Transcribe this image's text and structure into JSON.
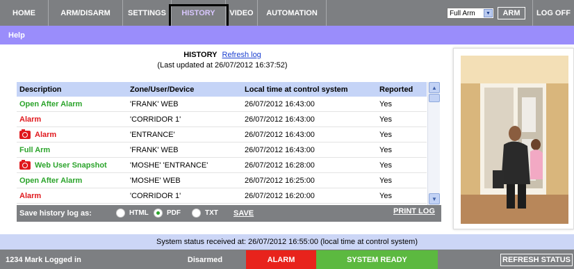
{
  "nav": {
    "items": [
      {
        "label": "HOME",
        "active": false
      },
      {
        "label": "ARM/DISARM",
        "active": false
      },
      {
        "label": "SETTINGS",
        "active": false
      },
      {
        "label": "HISTORY",
        "active": true
      },
      {
        "label": "VIDEO",
        "active": false
      },
      {
        "label": "AUTOMATION",
        "active": false
      }
    ],
    "arm_mode": "Full Arm",
    "arm_button": "ARM",
    "logoff": "LOG OFF"
  },
  "help": "Help",
  "history": {
    "title": "HISTORY",
    "refresh_link": "Refresh log",
    "updated": "(Last updated at 26/07/2012 16:37:52)",
    "columns": [
      "Description",
      "Zone/User/Device",
      "Local time at control system",
      "Reported"
    ],
    "rows": [
      {
        "desc": "Open After Alarm",
        "color": "#2ba42b",
        "icon": "",
        "zone": "'FRANK' WEB",
        "time": "26/07/2012 16:43:00",
        "reported": "Yes"
      },
      {
        "desc": "Alarm",
        "color": "#e0181d",
        "icon": "",
        "zone": "'CORRIDOR 1'",
        "time": "26/07/2012 16:43:00",
        "reported": "Yes"
      },
      {
        "desc": "Alarm",
        "color": "#e0181d",
        "icon": "camera-icon",
        "zone": "'ENTRANCE'",
        "time": "26/07/2012 16:43:00",
        "reported": "Yes"
      },
      {
        "desc": "Full Arm",
        "color": "#2ba42b",
        "icon": "",
        "zone": "'FRANK' WEB",
        "time": "26/07/2012 16:43:00",
        "reported": "Yes"
      },
      {
        "desc": "Web User Snapshot",
        "color": "#2ba42b",
        "icon": "camera-icon",
        "zone": "'MOSHE' 'ENTRANCE'",
        "time": "26/07/2012 16:28:00",
        "reported": "Yes"
      },
      {
        "desc": "Open After Alarm",
        "color": "#2ba42b",
        "icon": "",
        "zone": "'MOSHE' WEB",
        "time": "26/07/2012 16:25:00",
        "reported": "Yes"
      },
      {
        "desc": "Alarm",
        "color": "#e0181d",
        "icon": "",
        "zone": "'CORRIDOR 1'",
        "time": "26/07/2012 16:20:00",
        "reported": "Yes"
      }
    ],
    "save_label": "Save history log as:",
    "formats": [
      {
        "label": "HTML",
        "selected": false
      },
      {
        "label": "PDF",
        "selected": true
      },
      {
        "label": "TXT",
        "selected": false
      }
    ],
    "save_button": "SAVE",
    "print_button": "PRINT LOG"
  },
  "status_line": "System status received at: 26/07/2012 16:55:00 (local time at control system)",
  "bottom": {
    "user": "1234 Mark Logged in",
    "segments": [
      {
        "label": "Disarmed",
        "color": "#7d7f82"
      },
      {
        "label": "ALARM",
        "color": "#e8231c"
      },
      {
        "label": "SYSTEM READY",
        "color": "#5cb940"
      }
    ],
    "refresh": "REFRESH STATUS"
  }
}
